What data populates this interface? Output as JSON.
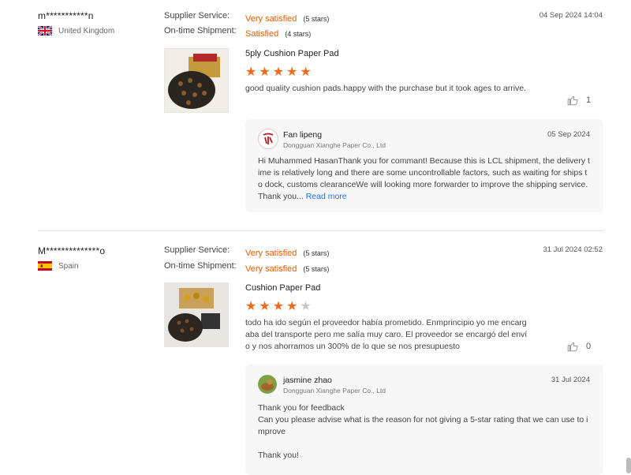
{
  "reviews": [
    {
      "buyer": "m***********n",
      "country": "United Kingdom",
      "supplier_service_label": "Supplier Service:",
      "supplier_service_rating": "Very satisfied",
      "supplier_service_stars": "(5 stars)",
      "shipment_label": "On-time Shipment:",
      "shipment_rating": "Satisfied",
      "shipment_stars": "(4 stars)",
      "date": "04 Sep 2024 14:04",
      "product_title": "5ply Cushion Paper Pad",
      "star_rating": 5,
      "content": "good quality cushion pads.happy with the purchase but it took ages to arrive.",
      "likes": "1",
      "reply": {
        "name": "Fan lipeng",
        "company": "Dongguan Xianghe Paper Co., Ltd",
        "date": "05 Sep 2024",
        "text": "Hi Muhammed HasanThank you for commant! Because this is LCL shipment, the delivery time is relatively long and there are some uncontrollable factors, such as waiting for ships to dock, customs clearanceWe will looking more forwarder to improve the shipping service.Thank you...",
        "read_more": "Read more"
      }
    },
    {
      "buyer": "M**************o",
      "country": "Spain",
      "supplier_service_label": "Supplier Service:",
      "supplier_service_rating": "Very satisfied",
      "supplier_service_stars": "(5 stars)",
      "shipment_label": "On-time Shipment:",
      "shipment_rating": "Very satisfied",
      "shipment_stars": "(5 stars)",
      "date": "31 Jul 2024 02:52",
      "product_title": "Cushion Paper Pad",
      "star_rating": 4,
      "content": "todo ha ido según el proveedor había prometido. Enmprincipio yo me encargaba del transporte pero me salía muy caro. El proveedor se encargó del envío y nos ahorramos un 300% de lo que se nos presupuesto",
      "likes": "0",
      "reply": {
        "name": "jasmine zhao",
        "company": "Dongguan Xianghe Paper Co., Ltd",
        "date": "31 Jul 2024",
        "text_lines": [
          "Thank you for feedback",
          "Can you please advise what is the reason for not giving a 5-star rating that we can use to improve",
          "",
          "Thank you!"
        ]
      }
    }
  ],
  "icons": {
    "like": "thumbs-up-icon",
    "star": "star-icon"
  },
  "colors": {
    "accent": "#e65c00",
    "star": "#f26b1d",
    "link": "#1a73e8"
  }
}
